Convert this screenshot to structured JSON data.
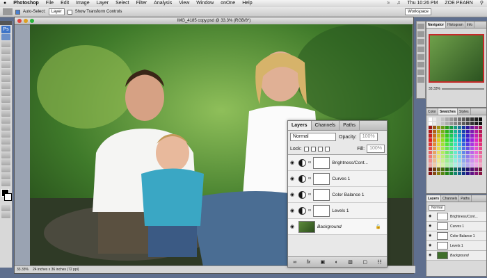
{
  "menubar": {
    "apple": "",
    "app": "Photoshop",
    "items": [
      "File",
      "Edit",
      "Image",
      "Layer",
      "Select",
      "Filter",
      "Analysis",
      "View",
      "Window",
      "onOne",
      "Help"
    ],
    "clock": "Thu 10:26 PM",
    "user": "ZOE PEARN"
  },
  "options": {
    "auto_select_label": "Auto-Select:",
    "auto_select_value": "Layer",
    "transform_label": "Show Transform Controls",
    "workspace": "Workspace"
  },
  "document": {
    "title": "IMG_4185 copy.psd @ 33.3% (RGB/8*)",
    "zoom": "33.33%",
    "size": "24 inches x 36 inches (72 ppi)"
  },
  "layers_panel": {
    "tabs": [
      "Layers",
      "Channels",
      "Paths"
    ],
    "active_tab": "Layers",
    "blend_mode": "Normal",
    "opacity_label": "Opacity:",
    "opacity": "100%",
    "lock_label": "Lock:",
    "fill_label": "Fill:",
    "fill": "100%",
    "layers": [
      {
        "name": "Brightness/Cont..."
      },
      {
        "name": "Curves 1"
      },
      {
        "name": "Color Balance 1"
      },
      {
        "name": "Levels 1"
      },
      {
        "name": "Background"
      }
    ]
  },
  "navigator_panel": {
    "tabs": [
      "Navigator",
      "Histogram",
      "Info"
    ],
    "zoom": "33.33%"
  },
  "color_panel": {
    "tabs": [
      "Color",
      "Swatches",
      "Styles"
    ]
  },
  "mini_layers_panel": {
    "tabs": [
      "Layers",
      "Channels",
      "Paths"
    ],
    "blend_mode": "Normal",
    "layers": [
      "Brightness/Cont...",
      "Curves 1",
      "Color Balance 1",
      "Levels 1",
      "Background"
    ]
  }
}
